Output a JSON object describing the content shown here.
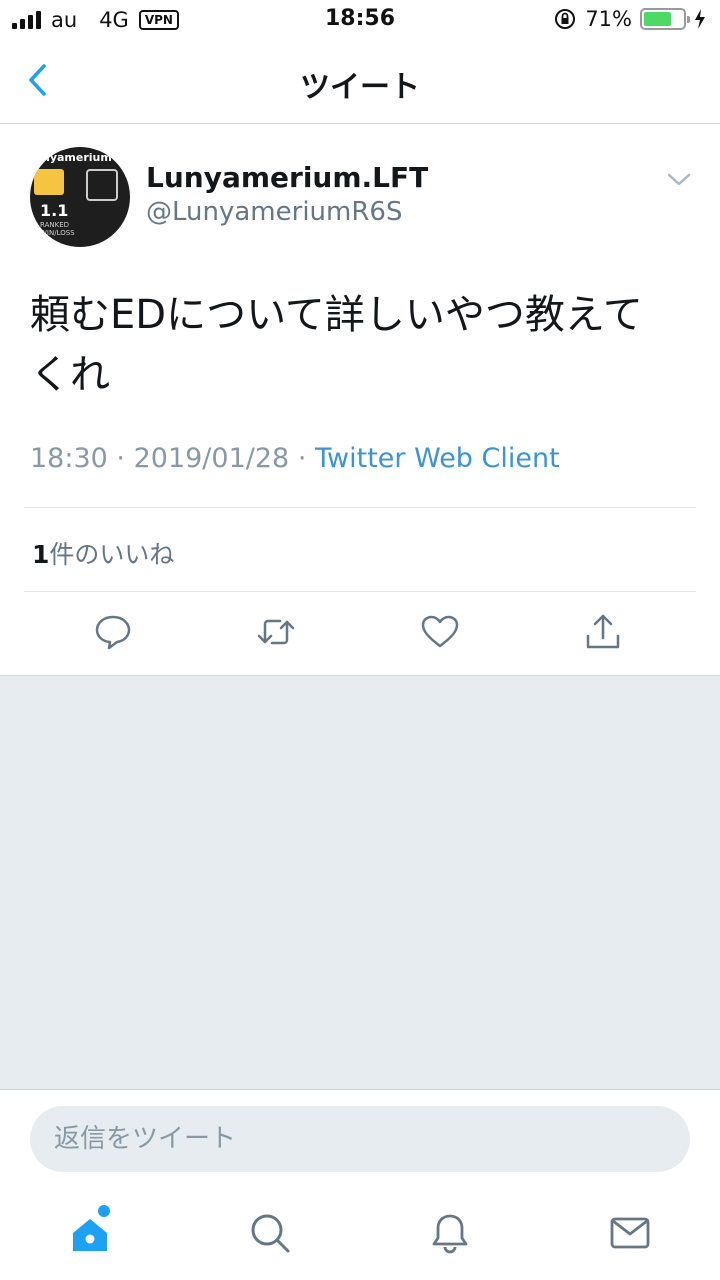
{
  "status_bar": {
    "carrier": "au",
    "network": "4G",
    "vpn": "VPN",
    "time": "18:56",
    "battery_percent": "71%",
    "battery_level": 0.71
  },
  "nav": {
    "title": "ツイート"
  },
  "tweet": {
    "display_name": "Lunyamerium.LFT",
    "handle": "@LunyameriumR6S",
    "avatar": {
      "top_text": "nyamerium",
      "number": "1.1",
      "small_line1": "RANKED",
      "small_line2": "WIN/LOSS"
    },
    "text_line1": "頼むEDについて詳しいやつ教えて",
    "text_line2": "くれ",
    "time": "18:30",
    "date": "2019/01/28",
    "client": "Twitter Web Client",
    "separator": "·",
    "likes_count": "1",
    "likes_label": "件のいいね"
  },
  "reply": {
    "placeholder": "返信をツイート"
  },
  "colors": {
    "accent": "#1da1f2",
    "link": "#3b94d9",
    "secondary_text": "#657786",
    "background_gray": "#e6ecf0"
  },
  "icons": {
    "back": "chevron-left-icon",
    "caret": "chevron-down-icon",
    "reply": "comment-icon",
    "retweet": "retweet-icon",
    "like": "heart-icon",
    "share": "share-icon",
    "home": "home-icon",
    "search": "search-icon",
    "notifications": "bell-icon",
    "messages": "envelope-icon"
  }
}
